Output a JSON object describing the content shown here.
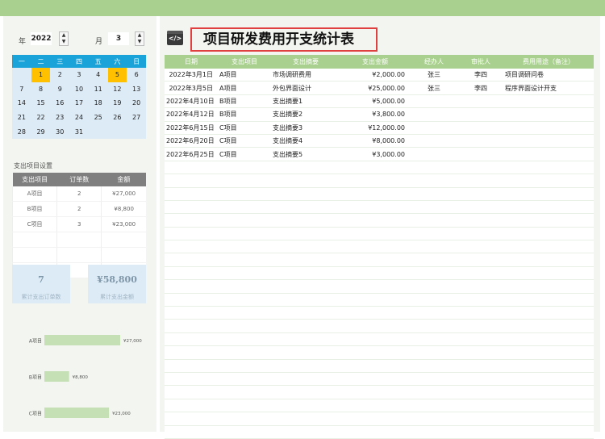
{
  "selectors": {
    "year_label": "年",
    "year_value": "2022",
    "month_label": "月",
    "month_value": "3"
  },
  "calendar": {
    "weekdays": [
      "一",
      "二",
      "三",
      "四",
      "五",
      "六",
      "日"
    ],
    "weeks": [
      [
        "",
        "1",
        "2",
        "3",
        "4",
        "5",
        "6"
      ],
      [
        "7",
        "8",
        "9",
        "10",
        "11",
        "12",
        "13"
      ],
      [
        "14",
        "15",
        "16",
        "17",
        "18",
        "19",
        "20"
      ],
      [
        "21",
        "22",
        "23",
        "24",
        "25",
        "26",
        "27"
      ],
      [
        "28",
        "29",
        "30",
        "31",
        "",
        "",
        ""
      ]
    ],
    "highlighted_days": [
      "1",
      "5"
    ],
    "highlight_color": "#ffc000",
    "header_color": "#1aa3d9"
  },
  "settings": {
    "title": "支出项目设置",
    "headers": [
      "支出项目",
      "订单数",
      "金额"
    ],
    "rows": [
      [
        "A项目",
        "2",
        "¥27,000"
      ],
      [
        "B项目",
        "2",
        "¥8,800"
      ],
      [
        "C项目",
        "3",
        "¥23,000"
      ]
    ]
  },
  "kpis": {
    "orders_value": "7",
    "orders_label": "累计支出订单数",
    "amount_value": "¥58,800",
    "amount_label": "累计支出金额"
  },
  "chart_data": {
    "type": "bar",
    "orientation": "horizontal",
    "categories": [
      "A项目",
      "B项目",
      "C项目"
    ],
    "values": [
      27000,
      8800,
      23000
    ],
    "labels": [
      "¥27,000",
      "¥8,800",
      "¥23,000"
    ],
    "color": "#c5e0b4"
  },
  "header": {
    "title": "项目研发费用开支统计表",
    "icon": "code-window-icon"
  },
  "table": {
    "headers": [
      "日期",
      "支出项目",
      "支出摘要",
      "支出金额",
      "经办人",
      "审批人",
      "费用用途（备注）"
    ],
    "rows": [
      [
        "2022年3月1日",
        "A项目",
        "市场调研费用",
        "¥2,000.00",
        "张三",
        "李四",
        "项目调研问卷"
      ],
      [
        "2022年3月5日",
        "A项目",
        "外包界面设计",
        "¥25,000.00",
        "张三",
        "李四",
        "程序界面设计开支"
      ],
      [
        "2022年4月10日",
        "B项目",
        "支出摘要1",
        "¥5,000.00",
        "",
        "",
        ""
      ],
      [
        "2022年4月12日",
        "B项目",
        "支出摘要2",
        "¥3,800.00",
        "",
        "",
        ""
      ],
      [
        "2022年6月15日",
        "C项目",
        "支出摘要3",
        "¥12,000.00",
        "",
        "",
        ""
      ],
      [
        "2022年6月20日",
        "C项目",
        "支出摘要4",
        "¥8,000.00",
        "",
        "",
        ""
      ],
      [
        "2022年6月25日",
        "C项目",
        "支出摘要5",
        "¥3,000.00",
        "",
        "",
        ""
      ]
    ]
  },
  "colors": {
    "accent_green": "#a9d08e",
    "panel_bg": "#f3f6f0",
    "title_border": "#e04040"
  }
}
